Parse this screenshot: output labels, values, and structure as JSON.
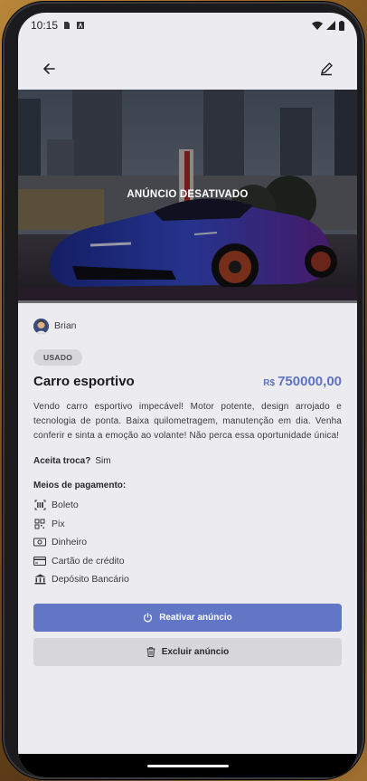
{
  "statusbar": {
    "time": "10:15",
    "icons": [
      "sim-card-icon",
      "app-a-icon",
      "wifi-icon",
      "signal-icon",
      "battery-icon"
    ]
  },
  "topbar": {
    "back_icon": "arrow-left-icon",
    "edit_icon": "pencil-icon"
  },
  "hero": {
    "status_text": "ANÚNCIO DESATIVADO"
  },
  "owner": {
    "name": "Brian"
  },
  "listing": {
    "condition": "USADO",
    "title": "Carro esportivo",
    "currency": "R$",
    "price": "750000,00",
    "description": "Vendo carro esportivo impecável! Motor potente, design arrojado e tecnologia de ponta. Baixa quilometragem, manutenção em dia. Venha conferir e sinta a emoção ao volante! Não perca essa oportunidade única!",
    "trade_label": "Aceita troca?",
    "trade_value": "Sim",
    "payment_label": "Meios de pagamento:",
    "payments": [
      {
        "icon": "barcode-icon",
        "label": "Boleto"
      },
      {
        "icon": "qrcode-icon",
        "label": "Pix"
      },
      {
        "icon": "money-icon",
        "label": "Dinheiro"
      },
      {
        "icon": "credit-card-icon",
        "label": "Cartão de crédito"
      },
      {
        "icon": "bank-icon",
        "label": "Depósito Bancário"
      }
    ]
  },
  "actions": {
    "reactivate_label": "Reativar anúncio",
    "delete_label": "Excluir anúncio"
  },
  "colors": {
    "accent": "#6276c6",
    "price": "#5f73c4",
    "background": "#ecebef"
  }
}
